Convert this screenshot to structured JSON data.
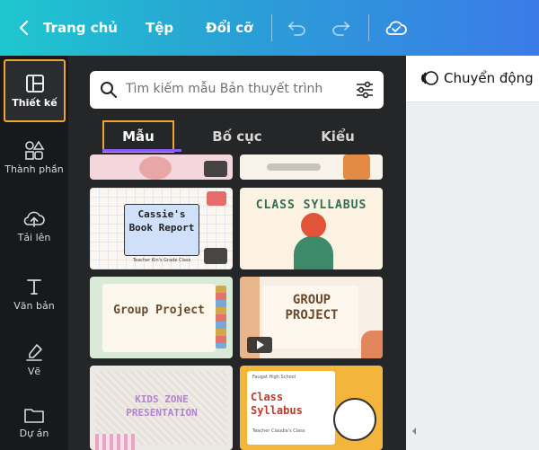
{
  "topbar": {
    "home_label": "Trang chủ",
    "file_label": "Tệp",
    "resize_label": "Đổi cỡ"
  },
  "rail": {
    "items": [
      {
        "label": "Thiết kế",
        "icon": "layout-icon"
      },
      {
        "label": "Thành phần",
        "icon": "shapes-icon"
      },
      {
        "label": "Tải lên",
        "icon": "cloud-upload-icon"
      },
      {
        "label": "Văn bản",
        "icon": "text-icon"
      },
      {
        "label": "Vẽ",
        "icon": "draw-icon"
      },
      {
        "label": "Dự án",
        "icon": "folder-icon"
      }
    ]
  },
  "panel": {
    "search_placeholder": "Tìm kiếm mẫu Bản thuyết trình",
    "tabs": [
      {
        "label": "Mẫu"
      },
      {
        "label": "Bố cục"
      },
      {
        "label": "Kiểu"
      }
    ],
    "templates": [
      {
        "title": "Cassie's Book Report",
        "caption": "Teacher Kin's Grade Class"
      },
      {
        "title": "CLASS SYLLABUS"
      },
      {
        "title": "Group Project"
      },
      {
        "title": "GROUP PROJECT"
      },
      {
        "title": "KIDS ZONE PRESENTATION"
      },
      {
        "title": "Class Syllabus",
        "header": "Faugat High School",
        "caption": "Teacher Claudia's Class"
      }
    ]
  },
  "right": {
    "motion_label": "Chuyển động"
  },
  "colors": {
    "accent_highlight": "#f1a330",
    "tab_underline": "#8b5cf6"
  }
}
